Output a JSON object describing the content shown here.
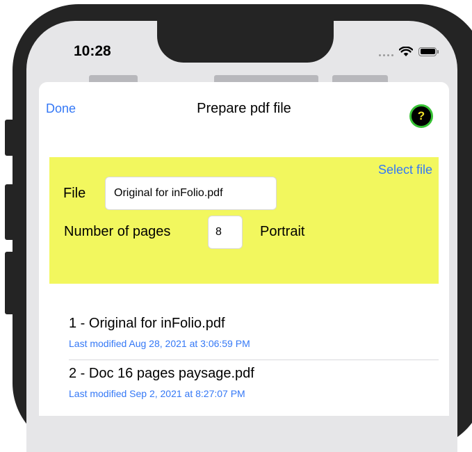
{
  "status_bar": {
    "time": "10:28"
  },
  "sheet": {
    "done_label": "Done",
    "title": "Prepare pdf file",
    "help_label": "?"
  },
  "panel": {
    "select_file_label": "Select file",
    "file_label": "File",
    "file_value": "Original for inFolio.pdf",
    "pages_label": "Number of pages",
    "pages_value": "8",
    "orientation": "Portrait",
    "background_color": "#f2f75e"
  },
  "files": [
    {
      "name": "1 - Original for inFolio.pdf",
      "modified": "Last modified Aug 28, 2021 at 3:06:59 PM"
    },
    {
      "name": "2 - Doc 16 pages paysage.pdf",
      "modified": "Last modified Sep 2, 2021 at 8:27:07 PM"
    }
  ],
  "colors": {
    "accent": "#3478f6",
    "help_ring": "#37c234",
    "help_mark": "#f3e32a"
  }
}
